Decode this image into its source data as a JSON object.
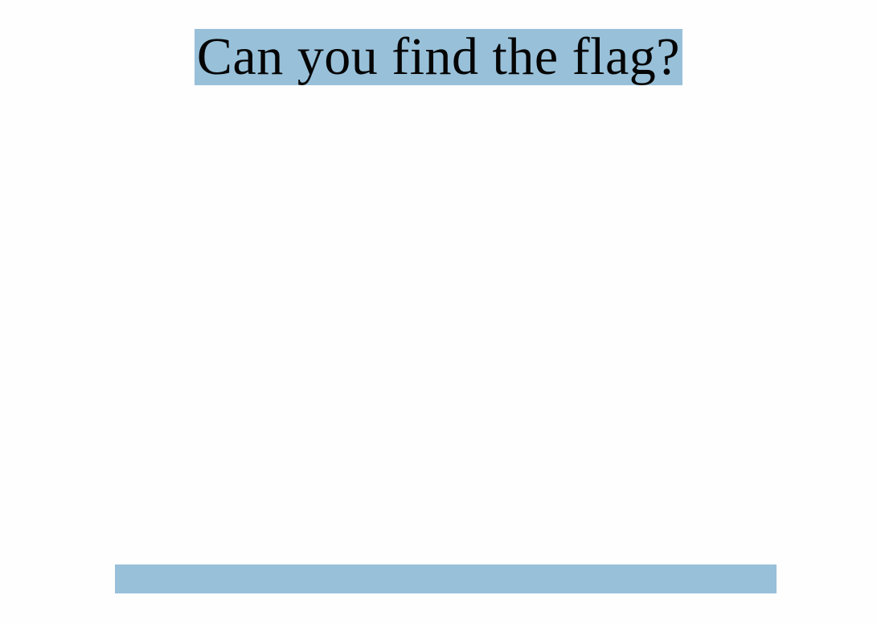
{
  "heading": {
    "text": "Can you find the flag?"
  },
  "colors": {
    "highlight": "#98c0d9",
    "text": "#050505",
    "background": "#fefefe"
  }
}
